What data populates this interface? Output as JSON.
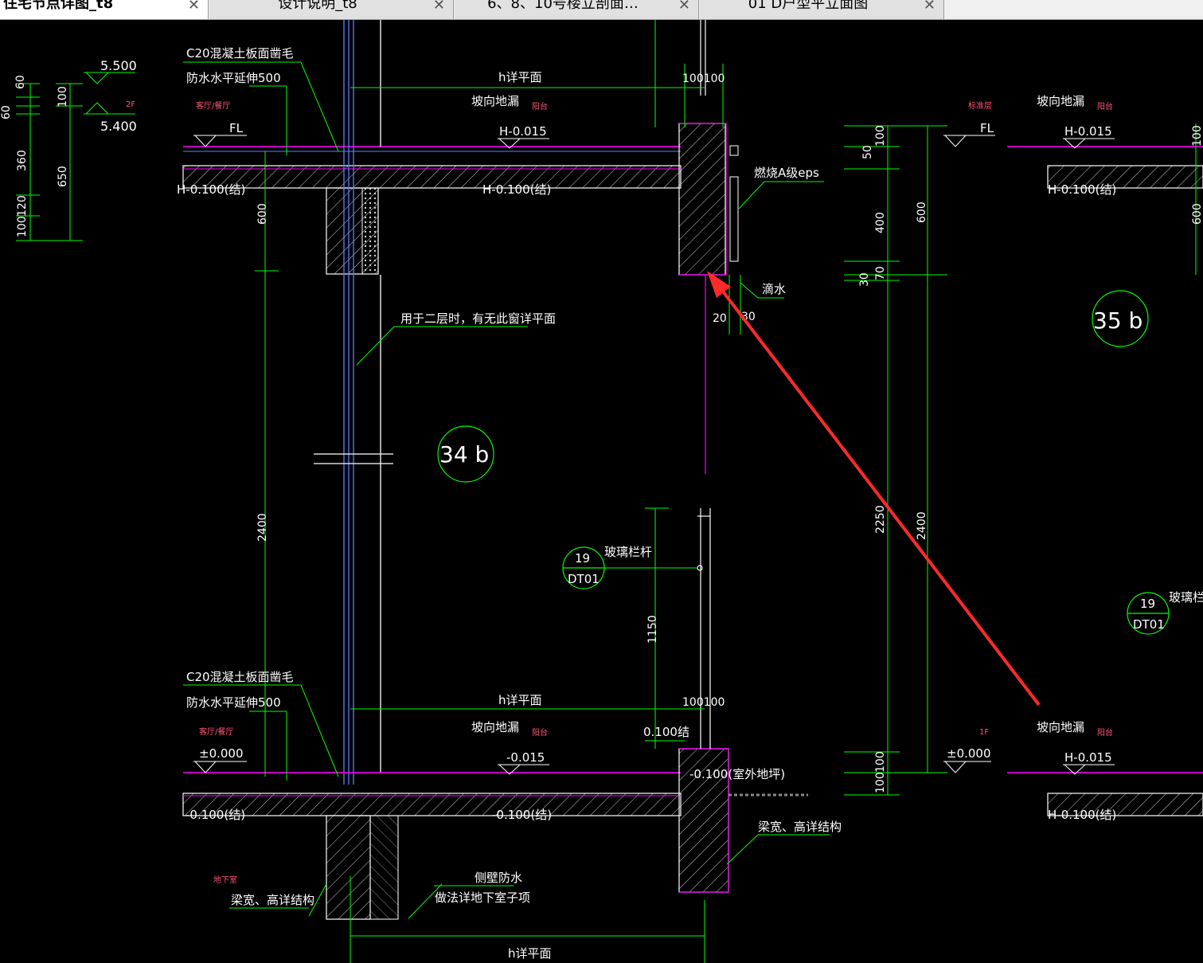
{
  "tabs": [
    {
      "label": "住宅节点详图_t8",
      "active": true
    },
    {
      "label": "设计说明_t8",
      "active": false
    },
    {
      "label": "6、8、10号楼立剖面…",
      "active": false
    },
    {
      "label": "01 D户型平立面图",
      "active": false
    }
  ],
  "close_glyph": "✕",
  "colors": {
    "background": "#000000",
    "lines": "#ffffff",
    "dimensions": "#00ff00",
    "slab": "#ff00ff",
    "highlight": "#ff2a2a",
    "accent": "#00d0ff"
  },
  "drawing": {
    "elev_5500": "5.500",
    "elev_5400": "5.400",
    "floor_2f": "2F",
    "floor_1f": "1F",
    "c20_note": "C20混凝土板面凿毛",
    "waterproof_note": "防水水平延伸500",
    "living_room": "客厅/餐厅",
    "fl": "FL",
    "h_plan": "h详平面",
    "slope_drain": "坡向地漏",
    "balcony": "阳台",
    "h_0015": "H-0.015",
    "h_0100": "H-0.100(结)",
    "eps": "燃烧A级eps",
    "drip": "滴水",
    "window_note": "用于二层时，有无此窗详平面",
    "detail_34b": "34 b",
    "detail_35b": "35 b",
    "std_floor": "标准层",
    "glass_rail": "玻璃栏杆",
    "ref_num": "19",
    "ref_sheet": "DT01",
    "zero": "±0.000",
    "m0015": "-0.015",
    "m0100": "-0.100(结)",
    "s0100": "0.100结",
    "outdoor": "-0.100(室外地坪)",
    "beam_note": "梁宽、高详结构",
    "basement": "地下室",
    "side_wp": "侧壁防水",
    "side_wp2": "做法详地下室子项",
    "dim_100100": "100100"
  },
  "dimensions": {
    "left": [
      "60",
      "100",
      "60",
      "360",
      "100",
      "120",
      "650"
    ],
    "middle": [
      "600",
      "2400",
      "1150",
      "20",
      "30"
    ],
    "right": [
      "50",
      "100",
      "400",
      "70",
      "30",
      "600",
      "2250",
      "2400",
      "100",
      "100"
    ],
    "far_right": [
      "100",
      "600"
    ]
  }
}
